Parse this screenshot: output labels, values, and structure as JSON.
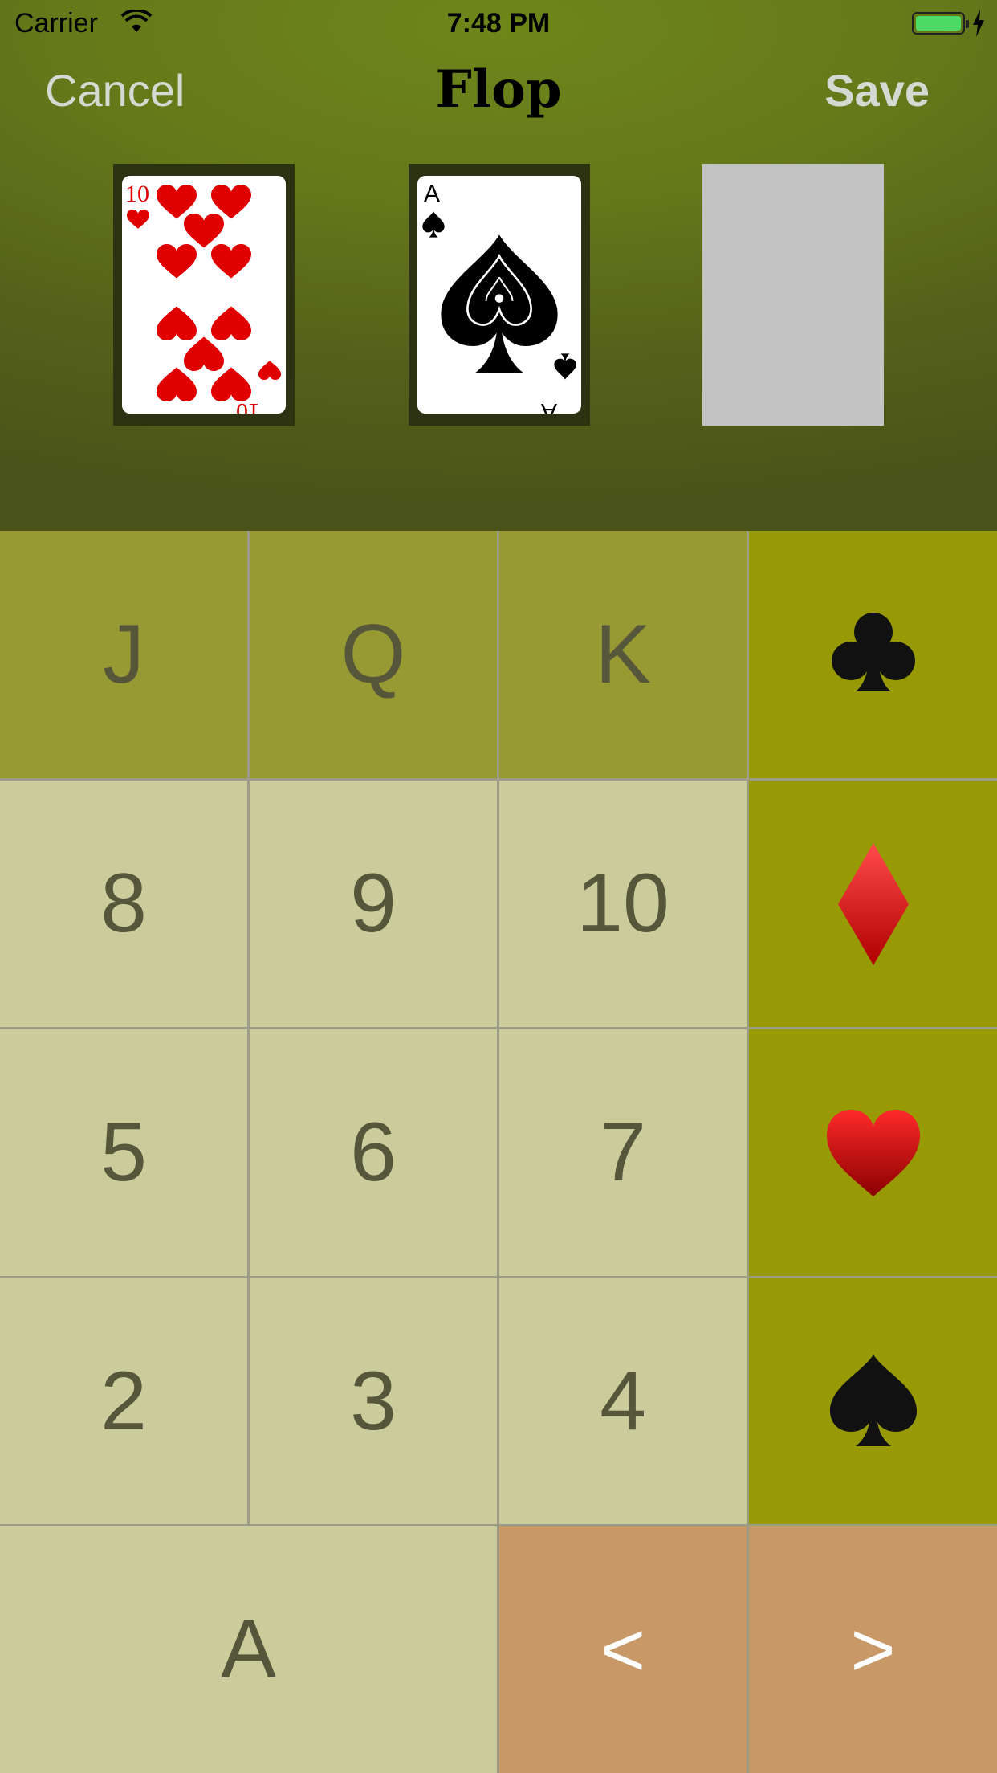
{
  "status_bar": {
    "carrier": "Carrier",
    "time": "7:48 PM"
  },
  "nav": {
    "cancel_label": "Cancel",
    "title": "Flop",
    "save_label": "Save"
  },
  "flop": {
    "cards": [
      {
        "rank": "10",
        "suit": "hearts",
        "state": "filled"
      },
      {
        "rank": "A",
        "suit": "spades",
        "state": "filled"
      },
      {
        "rank": "",
        "suit": "",
        "state": "empty"
      }
    ]
  },
  "keypad": {
    "face": [
      "J",
      "Q",
      "K"
    ],
    "row2": [
      "8",
      "9",
      "10"
    ],
    "row3": [
      "5",
      "6",
      "7"
    ],
    "row4": [
      "2",
      "3",
      "4"
    ],
    "ace": "A",
    "prev": "<",
    "next": ">",
    "suits": [
      "club-icon",
      "diamond-icon",
      "heart-icon",
      "spade-icon"
    ]
  },
  "colors": {
    "felt": "#66791a",
    "face_key": "#979933",
    "number_key": "#cbcc9b",
    "suit_key": "#979a05",
    "arrow_key": "#c89866",
    "heart_red": "#e00000"
  }
}
